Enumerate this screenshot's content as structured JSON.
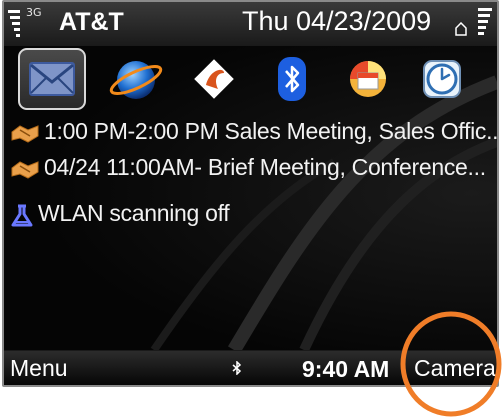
{
  "status_bar": {
    "network_type": "3G",
    "carrier": "AT&T",
    "date": "Thu 04/23/2009"
  },
  "app_shortcuts": [
    {
      "icon": "messaging-icon",
      "selected": true
    },
    {
      "icon": "web-browser-icon",
      "selected": false
    },
    {
      "icon": "ovi-store-icon",
      "selected": false
    },
    {
      "icon": "bluetooth-icon",
      "selected": false
    },
    {
      "icon": "calendar-icon",
      "selected": false
    },
    {
      "icon": "clock-icon",
      "selected": false
    }
  ],
  "events": [
    {
      "icon": "meeting-icon",
      "text": "1:00 PM-2:00 PM Sales Meeting, Sales Offic..."
    },
    {
      "icon": "meeting-icon",
      "text": "04/24 11:00AM- Brief Meeting, Conference..."
    }
  ],
  "wlan": {
    "icon": "wlan-icon",
    "text": "WLAN scanning off"
  },
  "softkeys": {
    "left": "Menu",
    "clock": "9:40 AM",
    "right": "Camera",
    "indicator_icon": "bluetooth-small-icon"
  },
  "colors": {
    "highlight_ring": "#f07d28",
    "background": "#0a0a0a",
    "text": "#ffffff",
    "wlan_icon": "#5a6cff"
  }
}
